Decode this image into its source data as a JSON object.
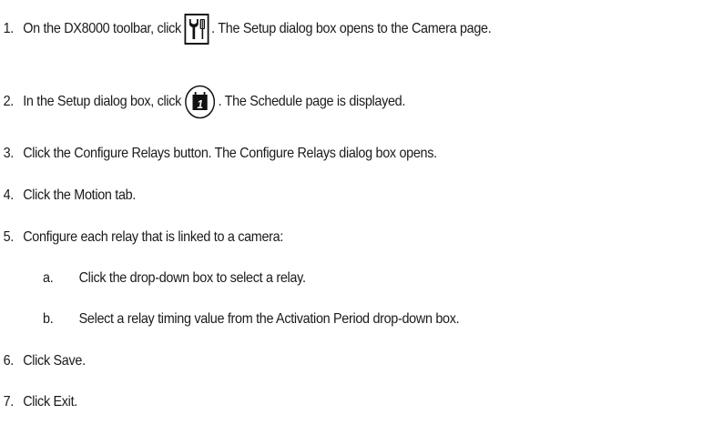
{
  "steps": [
    {
      "num": "1.",
      "before": "On the DX8000 toolbar, click",
      "icon": "setup-tools-icon",
      "after": ". The Setup dialog box opens to the Camera page."
    },
    {
      "num": "2.",
      "before": "In the Setup dialog box, click",
      "icon": "schedule-calendar-icon",
      "after": ". The Schedule page is displayed."
    },
    {
      "num": "3.",
      "text": "Click the Configure Relays button. The Configure Relays dialog box opens."
    },
    {
      "num": "4.",
      "text": "Click the Motion tab."
    },
    {
      "num": "5.",
      "text": "Configure each relay that is linked to a camera:",
      "substeps": [
        {
          "num": "a.",
          "text": "Click the drop-down box to select a relay."
        },
        {
          "num": "b.",
          "text": "Select a relay timing value from the Activation Period drop-down box."
        }
      ]
    },
    {
      "num": "6.",
      "text": "Click Save."
    },
    {
      "num": "7.",
      "text": "Click Exit."
    }
  ],
  "icons": {
    "schedule_day": "1"
  },
  "colors": {
    "text": "#1a1a1a",
    "icon": "#111111"
  }
}
